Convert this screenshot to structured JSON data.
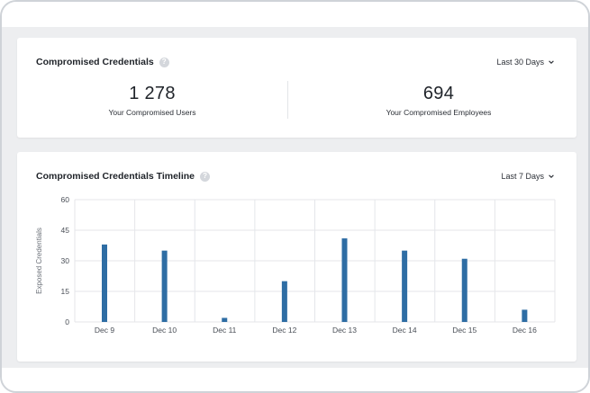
{
  "credentials_card": {
    "title": "Compromised Credentials",
    "help_icon": "question-circle-icon",
    "period_label": "Last 30 Days",
    "users": {
      "value": "1 278",
      "label": "Your Compromised Users"
    },
    "employees": {
      "value": "694",
      "label": "Your Compromised Employees"
    }
  },
  "timeline_card": {
    "title": "Compromised Credentials Timeline",
    "help_icon": "question-circle-icon",
    "period_label": "Last 7 Days"
  },
  "colors": {
    "bar": "#2e6da4",
    "grid": "#e4e6ea",
    "background": "#edeef0"
  },
  "chart_data": {
    "type": "bar",
    "categories": [
      "Dec 9",
      "Dec 10",
      "Dec 11",
      "Dec 12",
      "Dec 13",
      "Dec 14",
      "Dec 15",
      "Dec 16"
    ],
    "values": [
      38,
      35,
      2,
      20,
      41,
      35,
      31,
      6
    ],
    "ylabel": "Exposed Credentials",
    "xlabel": "",
    "ylim": [
      0,
      60
    ],
    "yticks": [
      0,
      15,
      30,
      45,
      60
    ],
    "grid": true
  }
}
